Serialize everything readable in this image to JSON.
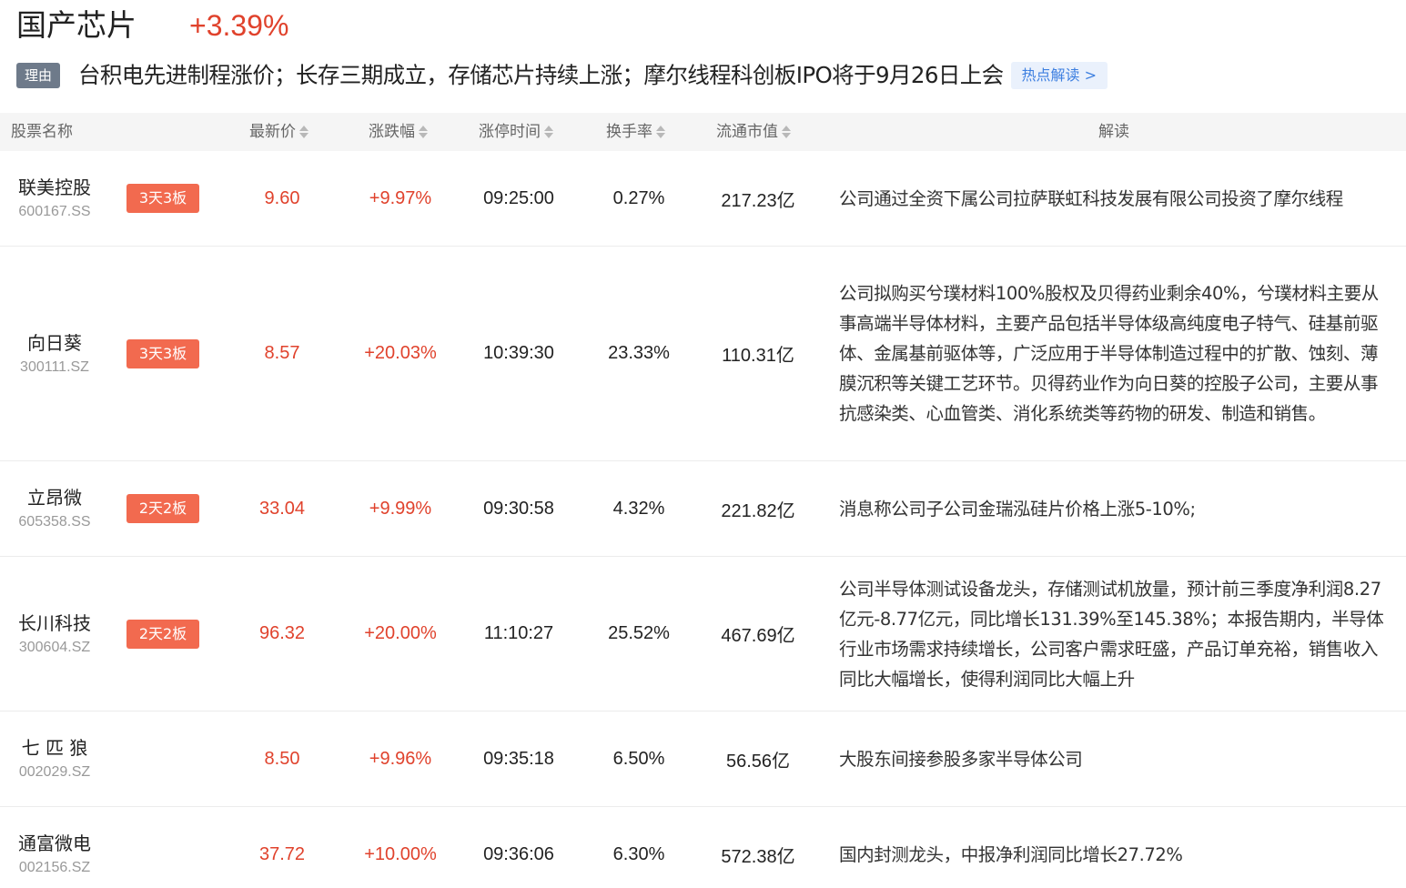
{
  "header": {
    "title": "国产芯片",
    "change": "+3.39%"
  },
  "reason": {
    "tag": "理由",
    "text": "台积电先进制程涨价；长存三期成立，存储芯片持续上涨；摩尔线程科创板IPO将于9月26日上会",
    "hot_link": "热点解读 >"
  },
  "table": {
    "columns": {
      "name": "股票名称",
      "price": "最新价",
      "change": "涨跌幅",
      "limit_time": "涨停时间",
      "turnover": "换手率",
      "market_cap": "流通市值",
      "analysis": "解读"
    },
    "rows": [
      {
        "name": "联美控股",
        "code": "600167.SS",
        "badge": "3天3板",
        "price": "9.60",
        "change": "+9.97%",
        "time": "09:25:00",
        "turnover": "0.27%",
        "cap": "217.23亿",
        "analysis": "公司通过全资下属公司拉萨联虹科技发展有限公司投资了摩尔线程"
      },
      {
        "name": "向日葵",
        "code": "300111.SZ",
        "badge": "3天3板",
        "price": "8.57",
        "change": "+20.03%",
        "time": "10:39:30",
        "turnover": "23.33%",
        "cap": "110.31亿",
        "analysis": "公司拟购买兮璞材料100%股权及贝得药业剩余40%，兮璞材料主要从事高端半导体材料，主要产品包括半导体级高纯度电子特气、硅基前驱体、金属基前驱体等，广泛应用于半导体制造过程中的扩散、蚀刻、薄膜沉积等关键工艺环节。贝得药业作为向日葵的控股子公司，主要从事抗感染类、心血管类、消化系统类等药物的研发、制造和销售。"
      },
      {
        "name": "立昂微",
        "code": "605358.SS",
        "badge": "2天2板",
        "price": "33.04",
        "change": "+9.99%",
        "time": "09:30:58",
        "turnover": "4.32%",
        "cap": "221.82亿",
        "analysis": "消息称公司子公司金瑞泓硅片价格上涨5-10%;"
      },
      {
        "name": "长川科技",
        "code": "300604.SZ",
        "badge": "2天2板",
        "price": "96.32",
        "change": "+20.00%",
        "time": "11:10:27",
        "turnover": "25.52%",
        "cap": "467.69亿",
        "analysis": "公司半导体测试设备龙头，存储测试机放量，预计前三季度净利润8.27亿元-8.77亿元，同比增长131.39%至145.38%；本报告期内，半导体行业市场需求持续增长，公司客户需求旺盛，产品订单充裕，销售收入同比大幅增长，使得利润同比大幅上升"
      },
      {
        "name": "七 匹 狼",
        "code": "002029.SZ",
        "badge": "",
        "price": "8.50",
        "change": "+9.96%",
        "time": "09:35:18",
        "turnover": "6.50%",
        "cap": "56.56亿",
        "analysis": "大股东间接参股多家半导体公司"
      },
      {
        "name": "通富微电",
        "code": "002156.SZ",
        "badge": "",
        "price": "37.72",
        "change": "+10.00%",
        "time": "09:36:06",
        "turnover": "6.30%",
        "cap": "572.38亿",
        "analysis": "国内封测龙头，中报净利润同比增长27.72%"
      }
    ]
  }
}
